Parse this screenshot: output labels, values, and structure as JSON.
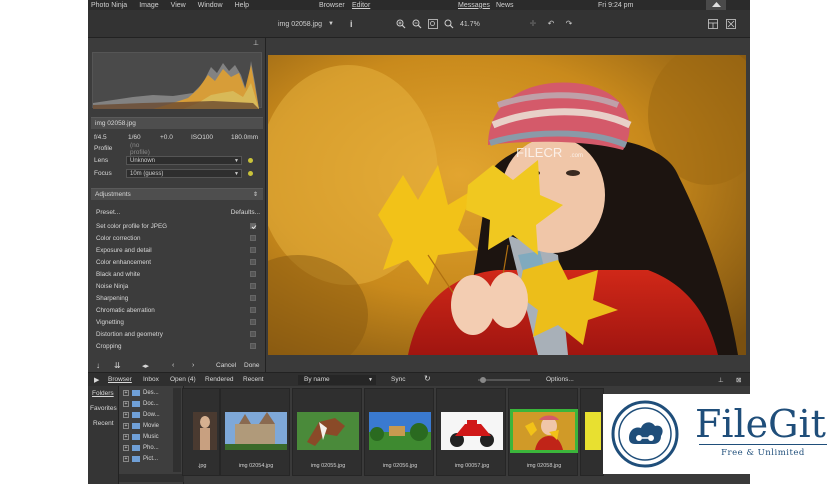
{
  "menubar": {
    "items": [
      "Photo Ninja",
      "Image",
      "View",
      "Window",
      "Help"
    ],
    "browser": "Browser",
    "editor": "Editor",
    "messages": "Messages",
    "news": "News",
    "clock": "Fri 9:24 pm"
  },
  "toolbar": {
    "filename": "img 02058.jpg",
    "zoom": "41.7%"
  },
  "info": {
    "file": "img 02058.jpg",
    "aperture": "f/4.5",
    "shutter": "1/60",
    "exposure": "+0.0",
    "iso": "ISO100",
    "focal": "180.0mm",
    "profile_label": "Profile",
    "profile_value": "(no profile)",
    "lens_label": "Lens",
    "lens_value": "Unknown",
    "focus_label": "Focus",
    "focus_value": "10m (guess)"
  },
  "adjustments": {
    "header": "Adjustments",
    "preset": "Preset...",
    "defaults": "Defaults...",
    "items": [
      {
        "label": "Set color profile for JPEG",
        "checked": true
      },
      {
        "label": "Color correction",
        "checked": false
      },
      {
        "label": "Exposure and detail",
        "checked": false
      },
      {
        "label": "Color enhancement",
        "checked": false
      },
      {
        "label": "Black and white",
        "checked": false
      },
      {
        "label": "Noise Ninja",
        "checked": false
      },
      {
        "label": "Sharpening",
        "checked": false
      },
      {
        "label": "Chromatic aberration",
        "checked": false
      },
      {
        "label": "Vignetting",
        "checked": false
      },
      {
        "label": "Distortion and geometry",
        "checked": false
      },
      {
        "label": "Cropping",
        "checked": false
      }
    ],
    "cancel": "Cancel",
    "done": "Done"
  },
  "photo": {
    "watermark": "FILECR",
    "watermark_sub": ".com"
  },
  "browserbar": {
    "browser": "Browser",
    "inbox": "Inbox",
    "open": "Open (4)",
    "rendered": "Rendered",
    "recent": "Recent",
    "sort": "By name",
    "sync": "Sync",
    "options": "Options..."
  },
  "nav": {
    "folders": "Folders",
    "favorites": "Favorites",
    "recent": "Recent"
  },
  "tree": [
    "Des...",
    "Doc...",
    "Dow...",
    "Movie",
    "Music",
    "Pho...",
    "Pict..."
  ],
  "thumbs": [
    {
      "caption": ".jpg"
    },
    {
      "caption": "img 02054.jpg"
    },
    {
      "caption": "img 02055.jpg"
    },
    {
      "caption": "img 02056.jpg"
    },
    {
      "caption": "img 00057.jpg"
    },
    {
      "caption": "img 02058.jpg"
    }
  ],
  "watermark": {
    "name": "FileGit",
    "tagline": "Free & Unlimited"
  },
  "colors": {
    "selection": "#3bb53b",
    "panel": "#3c3c3c",
    "brand": "#1f4e7a"
  }
}
